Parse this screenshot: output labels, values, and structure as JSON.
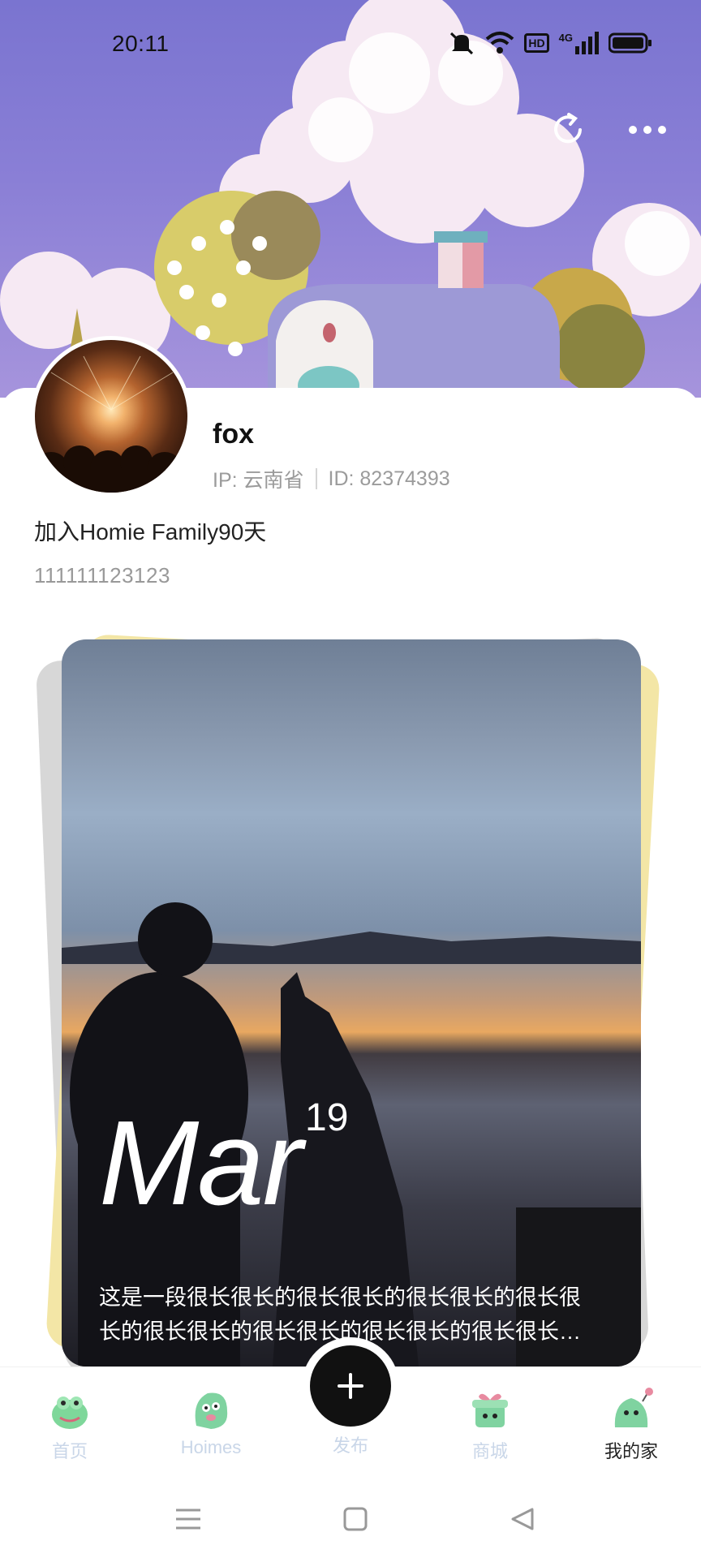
{
  "status_bar": {
    "time": "20:11",
    "icons": [
      "mute-bell-icon",
      "wifi-icon",
      "hd-icon",
      "signal-4g-icon",
      "battery-icon"
    ],
    "hd_text": "HD",
    "network_text": "4G"
  },
  "header_actions": {
    "refresh_icon": "refresh-icon",
    "more_icon": "more-dots-icon"
  },
  "profile": {
    "username": "fox",
    "ip": "IP: 云南省",
    "id": "ID: 82374393",
    "join_text": "加入Homie Family90天",
    "bio": "111111123123"
  },
  "card": {
    "month": "Mar",
    "day": "19",
    "text": "这是一段很长很长的很长很长的很长很长的很长很长的很长很长的很长很长的很长很长的很长很长…"
  },
  "tabbar": {
    "tabs": [
      {
        "label": "首页",
        "icon": "home-frog-icon",
        "active": false
      },
      {
        "label": "Hoimes",
        "icon": "hoimes-creature-icon",
        "active": false
      },
      {
        "label": "发布",
        "icon": "plus-icon",
        "active": false
      },
      {
        "label": "商城",
        "icon": "shop-gift-icon",
        "active": false
      },
      {
        "label": "我的家",
        "icon": "my-home-creature-icon",
        "active": true
      }
    ]
  },
  "system_nav": {
    "icons": [
      "menu-icon",
      "home-square-icon",
      "back-triangle-icon"
    ]
  },
  "colors": {
    "hero_sky": "#7a74d0",
    "inactive_tab": "#c9d6e8",
    "card_back_yellow": "#f3e6a6"
  }
}
